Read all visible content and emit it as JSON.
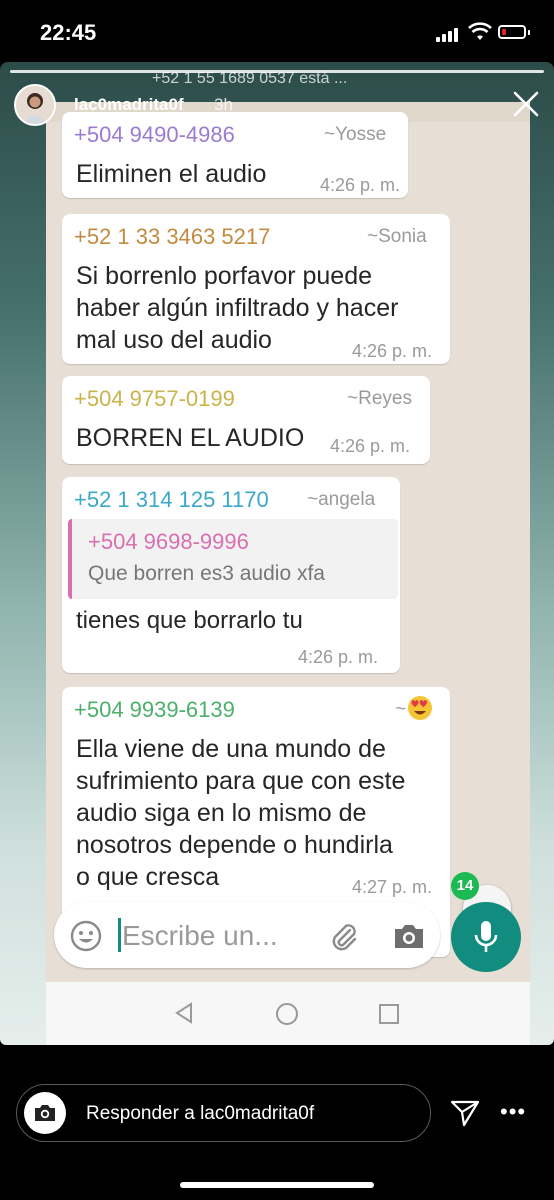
{
  "status_bar": {
    "time": "22:45"
  },
  "story": {
    "username": "lac0madrita0f",
    "age": "3h",
    "overlay_header": "+52 1 55 1689 0537 está ..."
  },
  "messages": [
    {
      "sender": "+504 9490-4986",
      "alias": "~Yosse",
      "sender_color": "#9b7bd1",
      "lines": [
        "Eliminen el audio"
      ],
      "time": "4:26 p. m."
    },
    {
      "sender": "+52 1 33 3463 5217",
      "alias": "~Sonia",
      "sender_color": "#c48b40",
      "lines": [
        "Si borrenlo porfavor puede",
        "haber algún infiltrado y hacer",
        "mal uso del audio"
      ],
      "time": "4:26 p. m."
    },
    {
      "sender": "+504 9757-0199",
      "alias": "~Reyes",
      "sender_color": "#c9b34a",
      "lines": [
        "BORREN EL AUDIO"
      ],
      "time": "4:26 p. m."
    },
    {
      "sender": "+52 1 314 125 1170",
      "alias": "~angela",
      "sender_color": "#3aa8c9",
      "reply": {
        "sender": "+504 9698-9996",
        "text": "Que borren es3 audio  xfa",
        "color": "#d870b0"
      },
      "lines": [
        "tienes que borrarlo tu"
      ],
      "time": "4:26 p. m."
    },
    {
      "sender": "+504 9939-6139",
      "alias": "~",
      "sender_color": "#4bb06b",
      "alias_emoji": "heart-eyes",
      "lines": [
        "Ella viene de una mundo de",
        "sufrimiento para que con este",
        "audio siga en lo mismo de",
        "nosotros depende o hundirla",
        "o que cresca"
      ],
      "time": "4:27 p. m."
    }
  ],
  "unread_count": "14",
  "composer": {
    "placeholder": "Escribe un..."
  },
  "reply_bar": {
    "placeholder": "Responder a lac0madrita0f"
  },
  "colors": {
    "wa_green": "#128c7e",
    "badge_green": "#1db954"
  }
}
